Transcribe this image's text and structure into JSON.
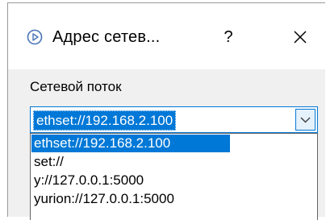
{
  "window": {
    "title": "Адрес сетев...",
    "help_label": "?",
    "close_icon": "close-icon",
    "app_icon": "play-circle-icon"
  },
  "form": {
    "label": "Сетевой поток",
    "combo_value": "ethset://192.168.2.100",
    "arrow_icon": "chevron-down-icon"
  },
  "dropdown": {
    "options": [
      {
        "label": "ethset://192.168.2.100",
        "selected": true
      },
      {
        "label": "set://",
        "selected": false
      },
      {
        "label": "y://127.0.0.1:5000",
        "selected": false
      },
      {
        "label": "yurion://127.0.0.1:5000",
        "selected": false
      }
    ]
  },
  "colors": {
    "accent": "#0078d7",
    "dialog_bg": "#f0f0f0",
    "title_bg": "#ffffff"
  }
}
